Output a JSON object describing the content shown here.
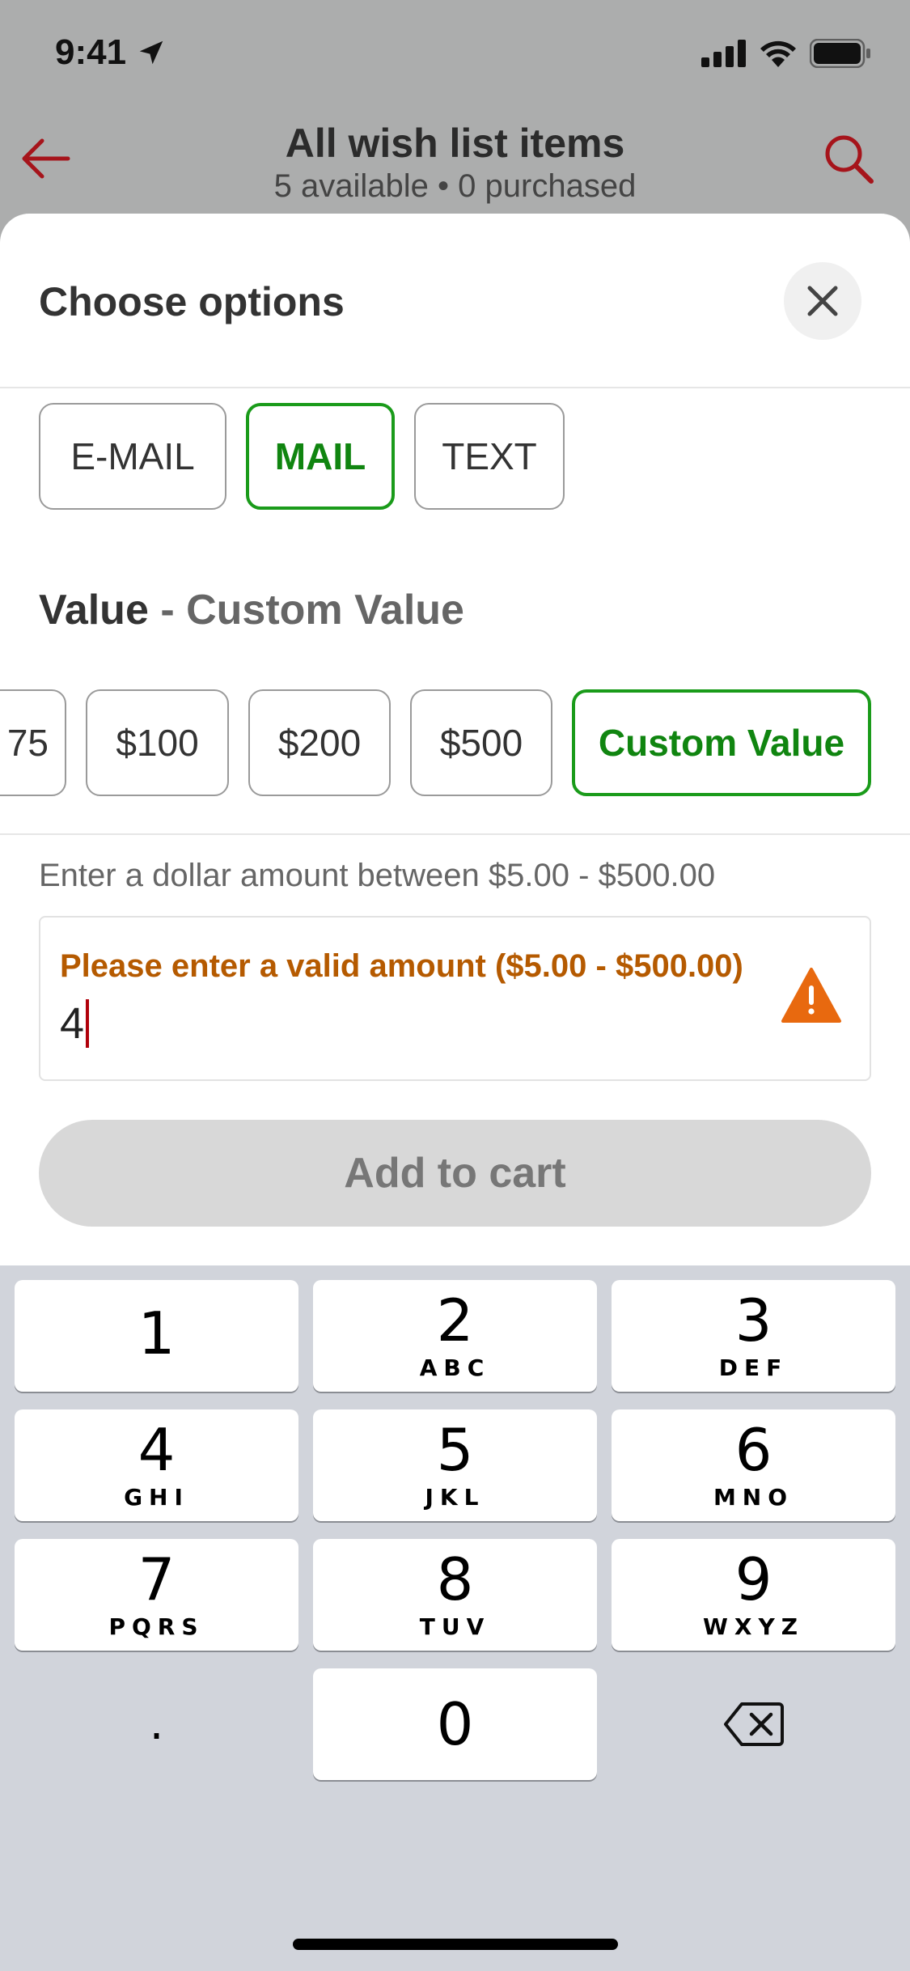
{
  "status_bar": {
    "time": "9:41"
  },
  "header": {
    "title": "All wish list items",
    "subtitle": "5 available • 0 purchased"
  },
  "sheet": {
    "title": "Choose options",
    "delivery_options": [
      {
        "label": "E-MAIL",
        "selected": false
      },
      {
        "label": "MAIL",
        "selected": true
      },
      {
        "label": "TEXT",
        "selected": false
      }
    ],
    "value_label": "Value",
    "value_separator": "-",
    "value_selected": "Custom Value",
    "amount_options": [
      {
        "label": "75",
        "selected": false
      },
      {
        "label": "$100",
        "selected": false
      },
      {
        "label": "$200",
        "selected": false
      },
      {
        "label": "$500",
        "selected": false
      },
      {
        "label": "Custom Value",
        "selected": true
      }
    ],
    "hint": "Enter a dollar amount between $5.00 - $500.00",
    "error": "Please enter a valid amount ($5.00 - $500.00)",
    "amount_value": "4",
    "add_to_cart": "Add to cart"
  },
  "keyboard": {
    "keys": [
      {
        "num": "1",
        "letters": ""
      },
      {
        "num": "2",
        "letters": "ABC"
      },
      {
        "num": "3",
        "letters": "DEF"
      },
      {
        "num": "4",
        "letters": "GHI"
      },
      {
        "num": "5",
        "letters": "JKL"
      },
      {
        "num": "6",
        "letters": "MNO"
      },
      {
        "num": "7",
        "letters": "PQRS"
      },
      {
        "num": "8",
        "letters": "TUV"
      },
      {
        "num": "9",
        "letters": "WXYZ"
      },
      {
        "num": "0",
        "letters": ""
      }
    ],
    "decimal": "."
  },
  "colors": {
    "brand_red": "#b5121b",
    "selected_green": "#1a9b1a",
    "warning_orange": "#e8690f",
    "error_text": "#b55a00"
  }
}
